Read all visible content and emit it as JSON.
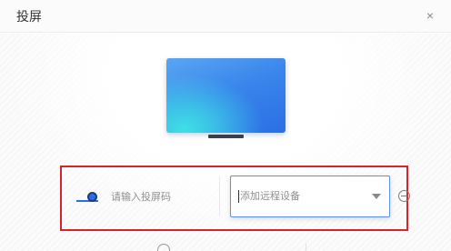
{
  "dialog": {
    "title": "投屏",
    "close_glyph": "×"
  },
  "connect": {
    "code_placeholder": "请输入投屏码",
    "device_select_placeholder": "添加远程设备"
  },
  "colors": {
    "highlight_border": "#d9232a",
    "accent_blue": "#2b6fe4"
  },
  "icons": {
    "close": "close-icon",
    "toggle": "toggle-icon",
    "dropdown": "chevron-down-icon",
    "remove": "remove-circle-icon"
  }
}
